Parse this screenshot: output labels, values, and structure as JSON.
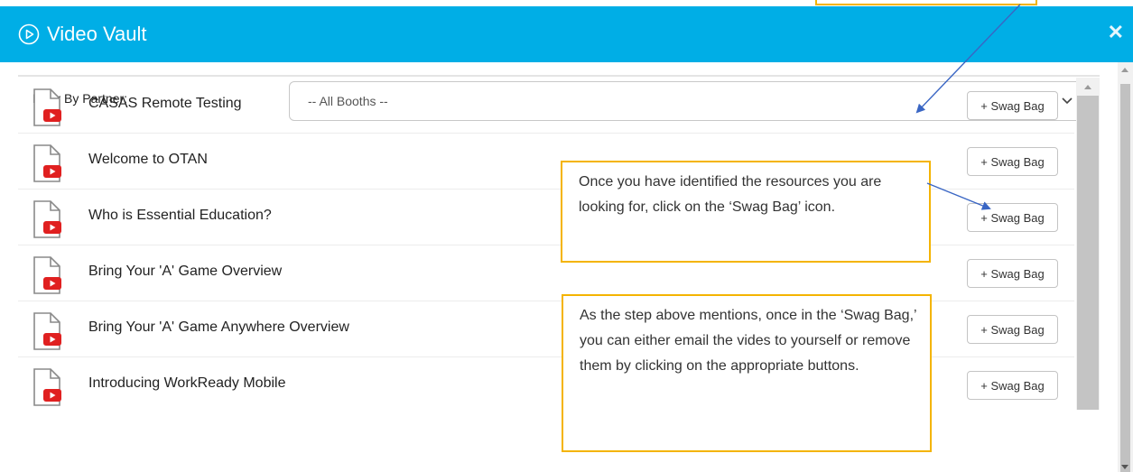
{
  "window": {
    "title": "Video Vault"
  },
  "filter": {
    "label": "Filter By Partner:",
    "value": "-- All Booths --"
  },
  "videos": [
    {
      "title": "CASAS Remote Testing",
      "button": "+ Swag Bag"
    },
    {
      "title": "Welcome to OTAN",
      "button": "+ Swag Bag"
    },
    {
      "title": "Who is Essential Education?",
      "button": "+ Swag Bag"
    },
    {
      "title": "Bring Your 'A' Game Overview",
      "button": "+ Swag Bag"
    },
    {
      "title": "Bring Your 'A' Game Anywhere Overview",
      "button": "+ Swag Bag"
    },
    {
      "title": "Introducing WorkReady Mobile",
      "button": "+ Swag Bag"
    }
  ],
  "callouts": [
    {
      "text": "Once you have identified the resources you are looking for, click on the ‘Swag Bag’ icon."
    },
    {
      "text": "As the step above mentions, once in the ‘Swag Bag,’ you can either email the vides to yourself or remove them by clicking on the appropriate buttons."
    }
  ],
  "icons": {
    "header": "play-circle-icon",
    "close": "close-icon",
    "select": "chevron-down-icon",
    "row": "video-file-icon"
  },
  "colors": {
    "header": "#00aee6",
    "callout_border": "#f4b400",
    "video_red": "#e02020",
    "arrow": "#3a66c4"
  }
}
